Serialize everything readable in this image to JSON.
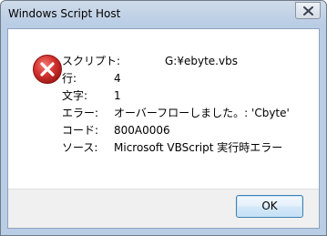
{
  "window": {
    "title": "Windows Script Host"
  },
  "message": {
    "lines": [
      {
        "label": "スクリプト:",
        "value": "G:¥ebyte.vbs"
      },
      {
        "label": "行:",
        "value": "4"
      },
      {
        "label": "文字:",
        "value": "1"
      },
      {
        "label": "エラー:",
        "value": "オーバーフローしました。: 'Cbyte'"
      },
      {
        "label": "コード:",
        "value": "800A0006"
      },
      {
        "label": "ソース:",
        "value": "Microsoft VBScript 実行時エラー"
      }
    ]
  },
  "buttons": {
    "ok_label": "OK"
  },
  "icons": {
    "error": "error-icon",
    "close": "close-icon"
  },
  "colors": {
    "error_red": "#d4332f",
    "button_border": "#3c7fb1"
  }
}
